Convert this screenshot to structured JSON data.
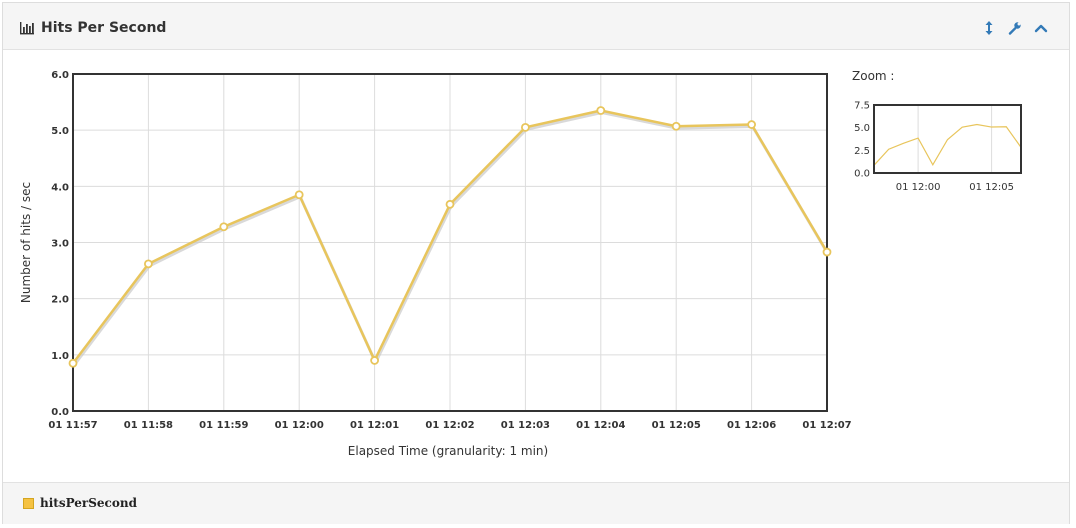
{
  "panel": {
    "title": "Hits Per Second",
    "title_icon": "bar-chart-icon",
    "tools": [
      {
        "name": "expand-vertical-icon",
        "symbol": "↕"
      },
      {
        "name": "wrench-icon",
        "symbol": "🔧"
      },
      {
        "name": "collapse-icon",
        "symbol": "^"
      }
    ]
  },
  "zoom": {
    "label": "Zoom :",
    "y_ticks": [
      "7.5",
      "5.0",
      "2.5",
      "0.0"
    ],
    "x_ticks": [
      "01 12:00",
      "01 12:05"
    ]
  },
  "legend": {
    "items": [
      {
        "label": "hitsPerSecond",
        "color": "#f5c242"
      }
    ]
  },
  "colors": {
    "series": "#e8c55c",
    "series_shadow": "#c9c9c9",
    "grid": "#dcdcdc",
    "axis": "#333333",
    "icon_blue": "#337ab7"
  },
  "chart_data": {
    "type": "line",
    "x_label": "Elapsed Time (granularity: 1 min)",
    "y_label": "Number of hits / sec",
    "categories": [
      "01 11:57",
      "01 11:58",
      "01 11:59",
      "01 12:00",
      "01 12:01",
      "01 12:02",
      "01 12:03",
      "01 12:04",
      "01 12:05",
      "01 12:06",
      "01 12:07"
    ],
    "y_ticks": [
      "0.0",
      "1.0",
      "2.0",
      "3.0",
      "4.0",
      "5.0",
      "6.0"
    ],
    "ylim": [
      0,
      6
    ],
    "grid": true,
    "legend_placement": "bottom-left",
    "series": [
      {
        "name": "hitsPerSecond",
        "values": [
          0.85,
          2.62,
          3.28,
          3.85,
          0.9,
          3.68,
          5.05,
          5.35,
          5.07,
          5.1,
          2.83
        ]
      }
    ]
  }
}
